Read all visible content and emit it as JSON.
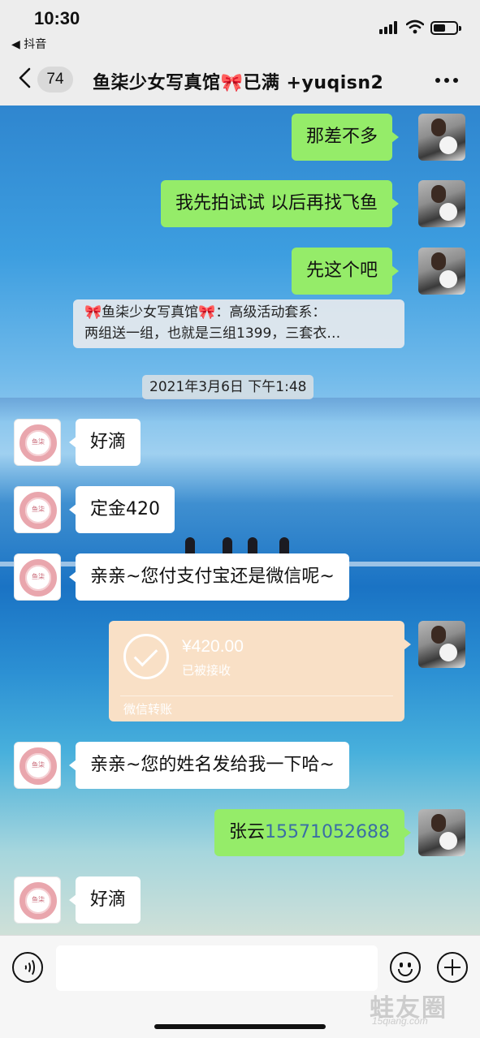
{
  "status_bar": {
    "time": "10:30",
    "back_app": "◀ 抖音"
  },
  "nav": {
    "unread_count": "74",
    "title": "鱼柒少女写真馆🎀已满 +yuqisn2"
  },
  "messages": [
    {
      "from": "me",
      "text": "那差不多"
    },
    {
      "from": "me",
      "text": "我先拍试试 以后再找飞鱼"
    },
    {
      "from": "me",
      "text": "先这个吧"
    }
  ],
  "quote": {
    "line1": "🎀鱼柒少女写真馆🎀：高级活动套系：",
    "line2": "两组送一组，也就是三组1399，三套衣…"
  },
  "timestamp": "2021年3月6日 下午1:48",
  "messages2": [
    {
      "from": "her",
      "text": "好滴",
      "avatar_text": "鱼柒"
    },
    {
      "from": "her",
      "text": "定金420",
      "avatar_text": "鱼柒"
    },
    {
      "from": "her",
      "text": "亲亲~您付支付宝还是微信呢~",
      "avatar_text": "鱼柒"
    }
  ],
  "transfer": {
    "amount": "¥420.00",
    "status": "已被接收",
    "label": "微信转账"
  },
  "messages3": [
    {
      "from": "her",
      "text": "亲亲~您的姓名发给我一下哈~",
      "avatar_text": "鱼柒"
    },
    {
      "from": "me",
      "name": "张云",
      "phone": "15571052688"
    },
    {
      "from": "her",
      "text": "好滴",
      "avatar_text": "鱼柒"
    }
  ],
  "input": {
    "placeholder": ""
  },
  "watermark": {
    "main": "蛙友圈",
    "sub": "15qiang.com"
  },
  "colors": {
    "my_bubble": "#95ec69",
    "their_bubble": "#ffffff",
    "transfer_card": "#f9e0c6",
    "phone_link": "#3a6ea5"
  }
}
